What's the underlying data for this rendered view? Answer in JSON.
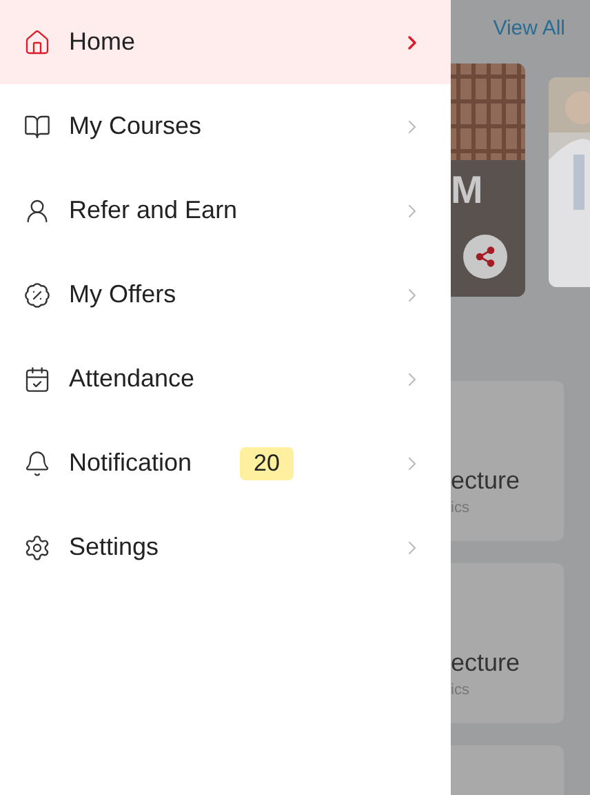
{
  "menu": {
    "items": [
      {
        "label": "Home",
        "selected": true
      },
      {
        "label": "My Courses",
        "selected": false
      },
      {
        "label": "Refer and Earn",
        "selected": false
      },
      {
        "label": "My Offers",
        "selected": false
      },
      {
        "label": "Attendance",
        "selected": false
      },
      {
        "label": "Notification",
        "selected": false,
        "badge": "20"
      },
      {
        "label": "Settings",
        "selected": false
      }
    ]
  },
  "background": {
    "view_all": "View All",
    "featured_title": "M",
    "cards": [
      {
        "title": "ecture",
        "subtitle": "ics"
      },
      {
        "title": "ecture",
        "subtitle": "ics"
      }
    ]
  }
}
